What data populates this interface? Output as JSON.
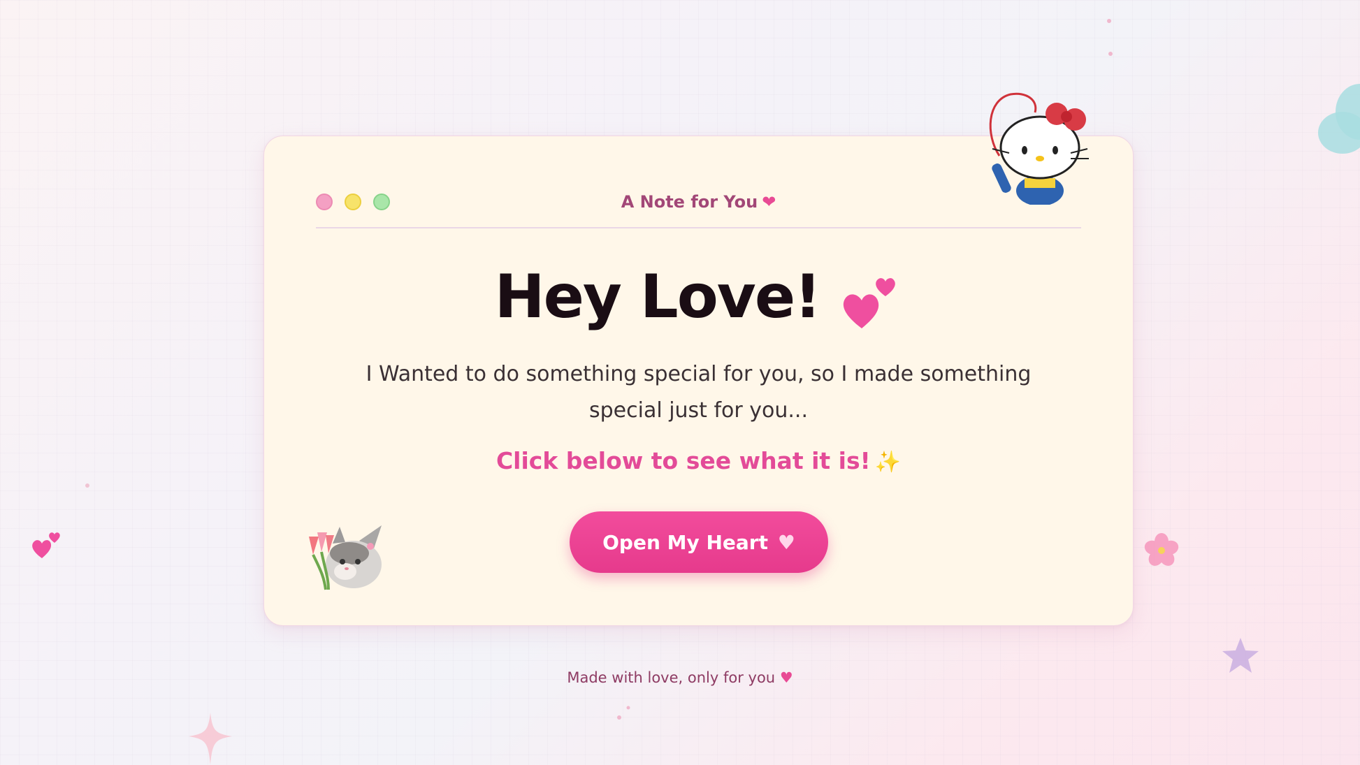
{
  "card": {
    "window_title": "A Note for You",
    "window_controls": [
      "close",
      "minimize",
      "maximize"
    ],
    "headline": "Hey Love!",
    "body": "I Wanted to do something special for you, so I made something special just for you...",
    "cta": "Click below to see what it is!",
    "button_label": "Open My Heart"
  },
  "footer": {
    "text": "Made with love, only for you"
  },
  "colors": {
    "card_bg": "#fff7e9",
    "accent": "#e63a8c",
    "title": "#a24777",
    "headline": "#1a0d14",
    "footer": "#8e3b63"
  },
  "decorations": [
    "hello-kitty-sticker",
    "kitten-with-tulips-sticker",
    "cherry-blossom-icon",
    "star-icon",
    "sparkle-star-icon",
    "cloud-icon",
    "two-hearts-icon"
  ]
}
